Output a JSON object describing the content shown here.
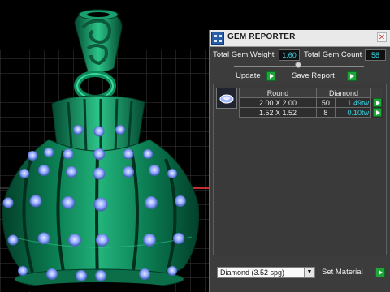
{
  "panel": {
    "title": "GEM REPORTER",
    "close_glyph": "✕",
    "total_weight_label": "Total Gem Weight",
    "total_weight_value": "1.60",
    "total_count_label": "Total Gem Count",
    "total_count_value": "58",
    "update_label": "Update",
    "save_report_label": "Save Report",
    "table": {
      "headers": [
        "Round",
        "Diamond"
      ],
      "rows": [
        {
          "size": "2.00 X 2.00",
          "count": "50",
          "weight": "1.49tw"
        },
        {
          "size": "1.52 X 1.52",
          "count": "8",
          "weight": "0.10tw"
        }
      ]
    },
    "material_select_value": "Diamond     (3.52 spg)",
    "set_material_label": "Set Material"
  },
  "icons": {
    "app": "gem-reporter-app-icon",
    "close": "close-icon",
    "play": "play-arrow-icon",
    "dropdown": "chevron-down-icon",
    "gem": "round-gem-thumbnail"
  },
  "colors": {
    "viewport_bg": "#000000",
    "grid": "#3a3a3a",
    "jewel_green": "#0f8a5a",
    "gem_blue": "#8fa8ff",
    "panel_bg": "#3c3c3c",
    "value_cyan": "#35d8e8",
    "button_green": "#1fa63a"
  }
}
